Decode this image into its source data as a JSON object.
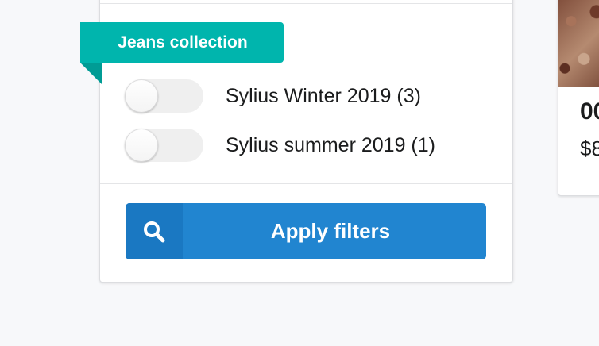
{
  "filter_panel": {
    "taxon_ribbon_label": "Jeans collection",
    "options": [
      {
        "label": "Sylius Winter 2019 (3)",
        "checked": false
      },
      {
        "label": "Sylius summer 2019 (1)",
        "checked": false
      }
    ],
    "apply_button_label": "Apply filters",
    "apply_icon": "search-icon"
  },
  "product_card": {
    "name_partial": "00",
    "price_partial": "$8"
  },
  "colors": {
    "ribbon": "#00b5ad",
    "primary_button": "#2185d0"
  }
}
